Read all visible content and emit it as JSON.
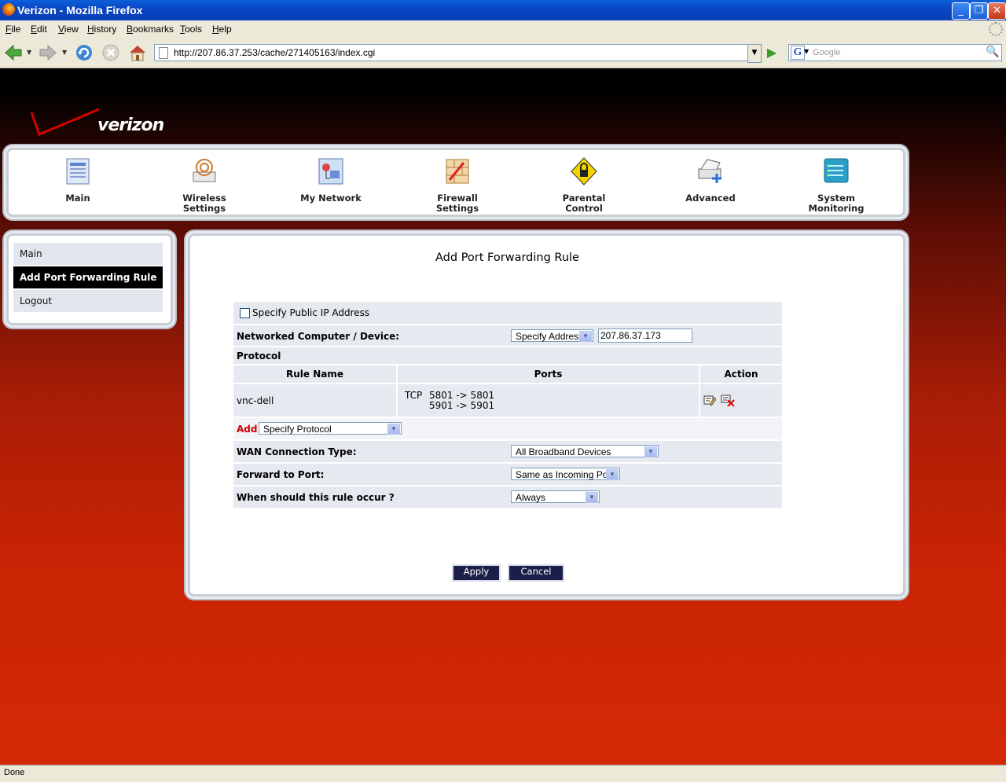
{
  "window": {
    "title": "Verizon - Mozilla Firefox"
  },
  "menubar": {
    "items": [
      "File",
      "Edit",
      "View",
      "History",
      "Bookmarks",
      "Tools",
      "Help"
    ]
  },
  "toolbar": {
    "url": "http://207.86.37.253/cache/271405163/index.cgi",
    "search_placeholder": "Google"
  },
  "brand": {
    "logo_text": "verizon",
    "accent_color": "#cc0000"
  },
  "topnav": {
    "items": [
      {
        "label_line1": "Main",
        "label_line2": ""
      },
      {
        "label_line1": "Wireless",
        "label_line2": "Settings"
      },
      {
        "label_line1": "My Network",
        "label_line2": ""
      },
      {
        "label_line1": "Firewall",
        "label_line2": "Settings"
      },
      {
        "label_line1": "Parental",
        "label_line2": "Control"
      },
      {
        "label_line1": "Advanced",
        "label_line2": ""
      },
      {
        "label_line1": "System",
        "label_line2": "Monitoring"
      }
    ]
  },
  "sidebar": {
    "items": [
      {
        "label": "Main"
      },
      {
        "label": "Add Port Forwarding Rule"
      },
      {
        "label": "Logout"
      }
    ]
  },
  "page": {
    "title": "Add Port Forwarding Rule",
    "specify_public_ip_label": "Specify Public IP Address",
    "networked_label": "Networked Computer / Device:",
    "networked_select": "Specify Address",
    "networked_address": "207.86.37.173",
    "protocol_label": "Protocol",
    "table_headers": {
      "rule_name": "Rule Name",
      "ports": "Ports",
      "action": "Action"
    },
    "rules": [
      {
        "name": "vnc-dell",
        "proto": "TCP",
        "ports_line1": "5801 -> 5801",
        "ports_line2": "5901 -> 5901"
      }
    ],
    "add_label": "Add",
    "add_select": "Specify Protocol",
    "wan_label": "WAN Connection Type:",
    "wan_select": "All Broadband Devices",
    "forward_label": "Forward to Port:",
    "forward_select": "Same as Incoming Port",
    "when_label": "When should this rule occur ?",
    "when_select": "Always",
    "apply_label": "Apply",
    "cancel_label": "Cancel"
  },
  "status": {
    "text": "Done"
  }
}
